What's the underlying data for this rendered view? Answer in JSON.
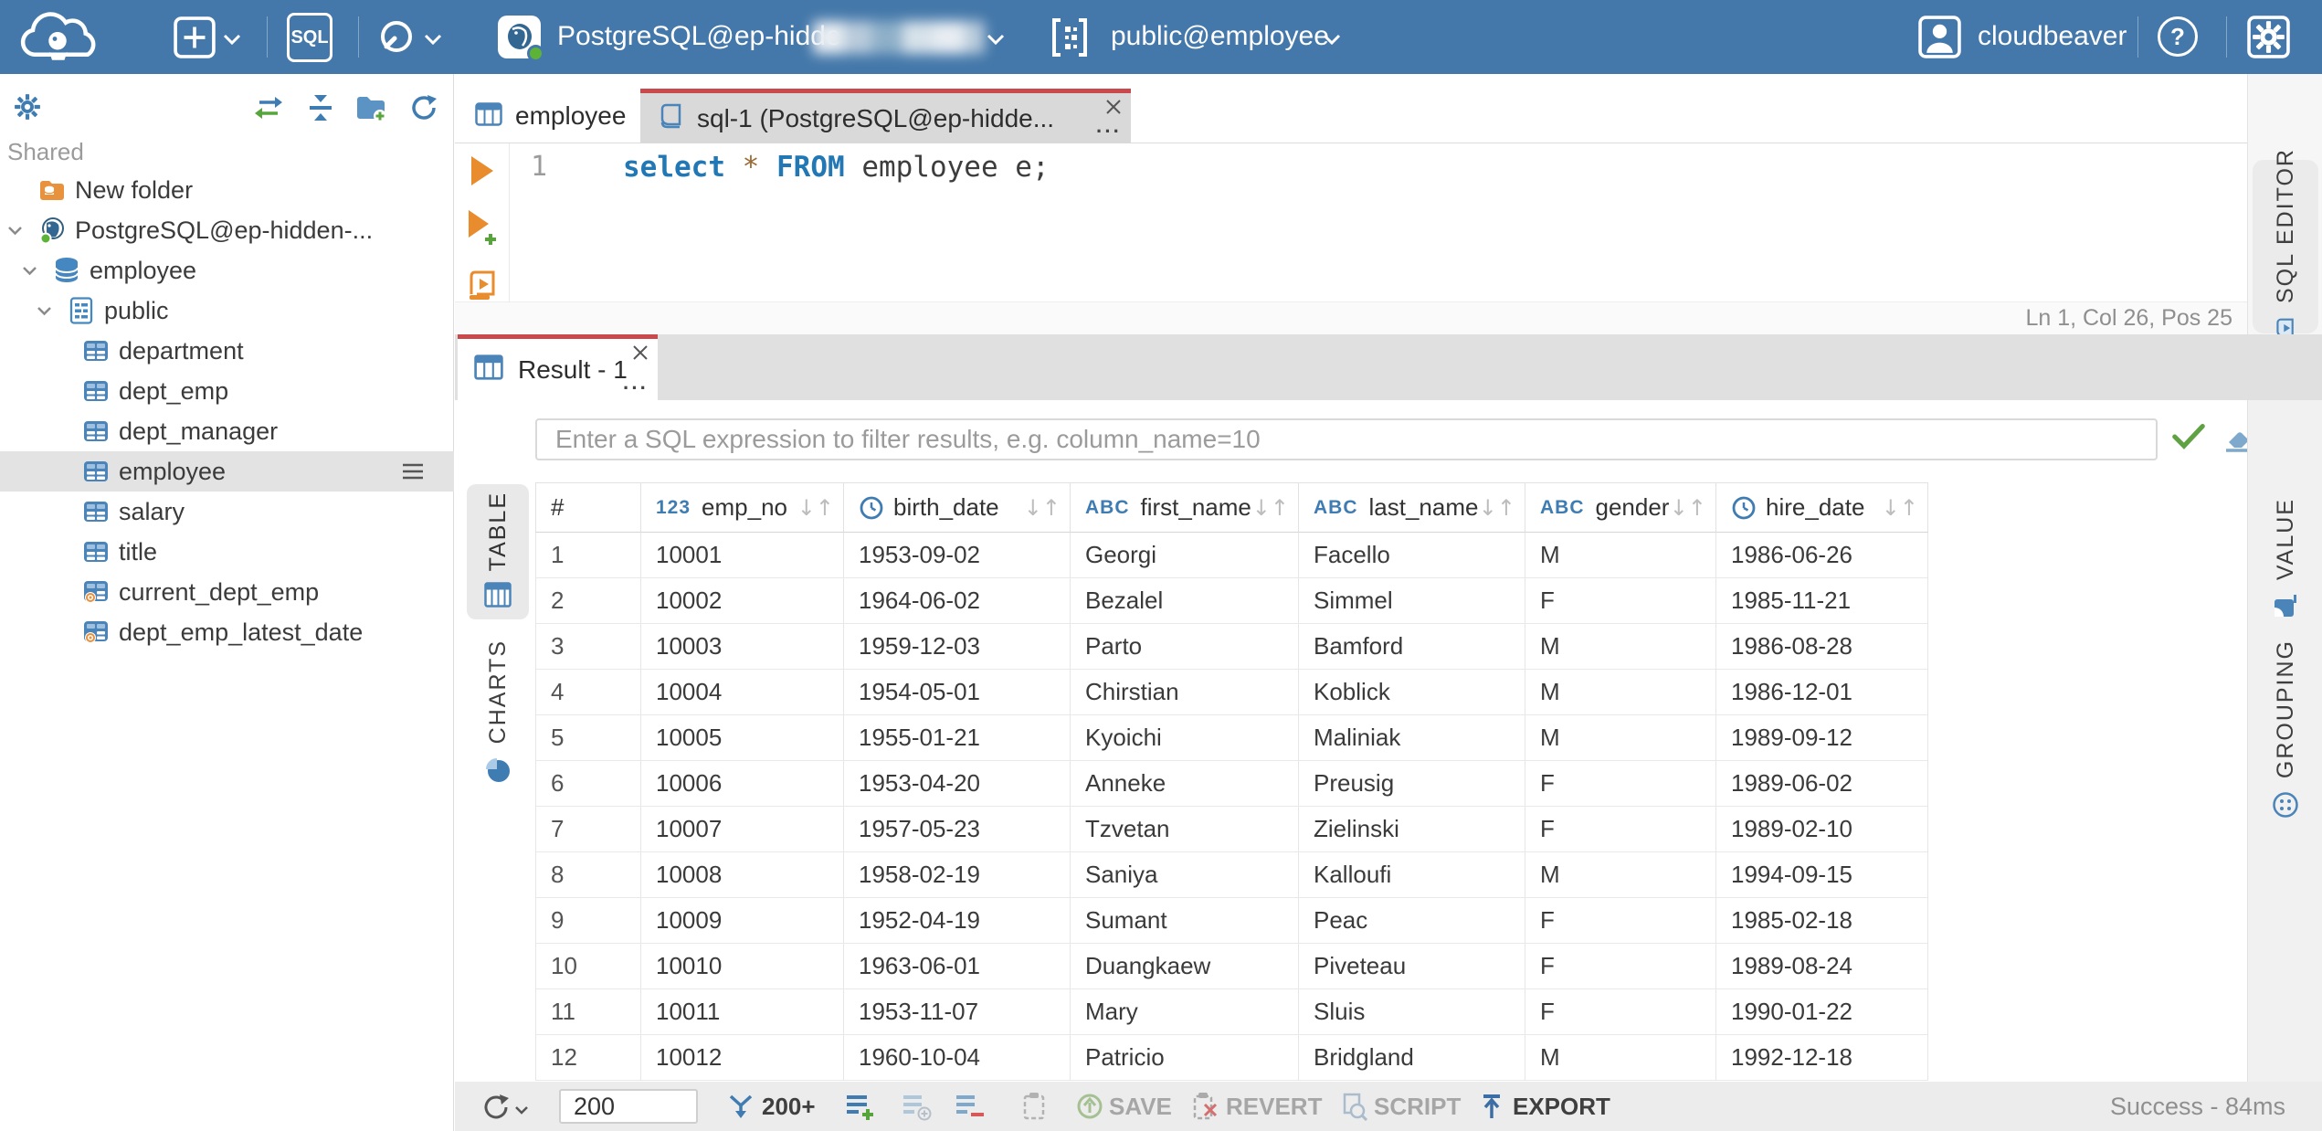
{
  "topbar": {
    "sql_button_label": "SQL",
    "connection_name": "PostgreSQL@ep-hidde",
    "schema_selector": "public@employee",
    "username": "cloudbeaver",
    "help_label": "?"
  },
  "sidebar": {
    "section_label": "Shared",
    "tree": [
      {
        "label": "New folder",
        "type": "folder",
        "depth": 0,
        "expanded": false,
        "selected": false
      },
      {
        "label": "PostgreSQL@ep-hidden-...",
        "type": "connection",
        "depth": 0,
        "expanded": true,
        "selected": false
      },
      {
        "label": "employee",
        "type": "database",
        "depth": 1,
        "expanded": true,
        "selected": false
      },
      {
        "label": "public",
        "type": "schema",
        "depth": 2,
        "expanded": true,
        "selected": false
      },
      {
        "label": "department",
        "type": "table",
        "depth": 3,
        "expanded": false,
        "selected": false
      },
      {
        "label": "dept_emp",
        "type": "table",
        "depth": 3,
        "expanded": false,
        "selected": false
      },
      {
        "label": "dept_manager",
        "type": "table",
        "depth": 3,
        "expanded": false,
        "selected": false
      },
      {
        "label": "employee",
        "type": "table",
        "depth": 3,
        "expanded": false,
        "selected": true
      },
      {
        "label": "salary",
        "type": "table",
        "depth": 3,
        "expanded": false,
        "selected": false
      },
      {
        "label": "title",
        "type": "table",
        "depth": 3,
        "expanded": false,
        "selected": false
      },
      {
        "label": "current_dept_emp",
        "type": "view",
        "depth": 3,
        "expanded": false,
        "selected": false
      },
      {
        "label": "dept_emp_latest_date",
        "type": "view",
        "depth": 3,
        "expanded": false,
        "selected": false
      }
    ]
  },
  "editor_tabs": [
    {
      "label": "employee",
      "active": false
    },
    {
      "label": "sql-1 (PostgreSQL@ep-hidde...",
      "active": true
    }
  ],
  "sql_editor": {
    "line_number": "1",
    "tokens": [
      {
        "text": "select",
        "style": "keyword"
      },
      {
        "text": " ",
        "style": "plain"
      },
      {
        "text": "*",
        "style": "star"
      },
      {
        "text": " ",
        "style": "plain"
      },
      {
        "text": "FROM",
        "style": "keyword"
      },
      {
        "text": " employee e;",
        "style": "plain"
      }
    ],
    "status_line": "Ln 1, Col 26, Pos 25",
    "side_tab_label": "SQL EDITOR"
  },
  "result": {
    "tab_label": "Result - 1",
    "filter_placeholder": "Enter a SQL expression to filter results, e.g. column_name=10",
    "left_tabs": [
      {
        "label": "TABLE",
        "active": true
      },
      {
        "label": "CHARTS",
        "active": false
      }
    ],
    "right_tabs": [
      {
        "label": "VALUE"
      },
      {
        "label": "GROUPING"
      }
    ],
    "grid": {
      "columns": [
        {
          "name": "#",
          "type": "rownum",
          "type_label": null
        },
        {
          "name": "emp_no",
          "type": "number",
          "type_label": "123"
        },
        {
          "name": "birth_date",
          "type": "datetime",
          "type_label": null
        },
        {
          "name": "first_name",
          "type": "string",
          "type_label": "ABC"
        },
        {
          "name": "last_name",
          "type": "string",
          "type_label": "ABC"
        },
        {
          "name": "gender",
          "type": "string",
          "type_label": "ABC"
        },
        {
          "name": "hire_date",
          "type": "datetime",
          "type_label": null
        }
      ],
      "rows": [
        [
          "1",
          "10001",
          "1953-09-02",
          "Georgi",
          "Facello",
          "M",
          "1986-06-26"
        ],
        [
          "2",
          "10002",
          "1964-06-02",
          "Bezalel",
          "Simmel",
          "F",
          "1985-11-21"
        ],
        [
          "3",
          "10003",
          "1959-12-03",
          "Parto",
          "Bamford",
          "M",
          "1986-08-28"
        ],
        [
          "4",
          "10004",
          "1954-05-01",
          "Chirstian",
          "Koblick",
          "M",
          "1986-12-01"
        ],
        [
          "5",
          "10005",
          "1955-01-21",
          "Kyoichi",
          "Maliniak",
          "M",
          "1989-09-12"
        ],
        [
          "6",
          "10006",
          "1953-04-20",
          "Anneke",
          "Preusig",
          "F",
          "1989-06-02"
        ],
        [
          "7",
          "10007",
          "1957-05-23",
          "Tzvetan",
          "Zielinski",
          "F",
          "1989-02-10"
        ],
        [
          "8",
          "10008",
          "1958-02-19",
          "Saniya",
          "Kalloufi",
          "M",
          "1994-09-15"
        ],
        [
          "9",
          "10009",
          "1952-04-19",
          "Sumant",
          "Peac",
          "F",
          "1985-02-18"
        ],
        [
          "10",
          "10010",
          "1963-06-01",
          "Duangkaew",
          "Piveteau",
          "F",
          "1989-08-24"
        ],
        [
          "11",
          "10011",
          "1953-11-07",
          "Mary",
          "Sluis",
          "F",
          "1990-01-22"
        ],
        [
          "12",
          "10012",
          "1960-10-04",
          "Patricio",
          "Bridgland",
          "M",
          "1992-12-18"
        ]
      ]
    },
    "toolbar": {
      "fetch_size": "200",
      "fetch_more_label": "200+",
      "save_label": "SAVE",
      "revert_label": "REVERT",
      "script_label": "SCRIPT",
      "export_label": "EXPORT",
      "status": "Success - 84ms"
    }
  },
  "colors": {
    "topbar_blue": "#4478aa",
    "accent_red": "#c9494d",
    "icon_blue": "#3f7cb2",
    "status_green": "#5cb338"
  }
}
